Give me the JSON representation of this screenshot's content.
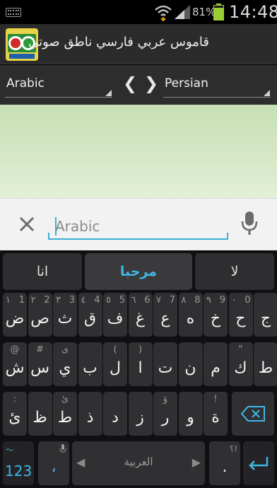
{
  "status_bar": {
    "battery_percent": "81%",
    "time": "14:48",
    "icons": [
      "keyboard-icon",
      "wifi-icon",
      "signal-icon",
      "battery-icon"
    ]
  },
  "app": {
    "title": "قاموس عربي فارسي ناطق صوتي",
    "icon": "app-logo-icon"
  },
  "languages": {
    "source": "Arabic",
    "target": "Persian",
    "left_arrow": "❮",
    "right_arrow": "❯"
  },
  "input": {
    "placeholder": "Arabic",
    "value": ""
  },
  "suggestions": {
    "left": "انا",
    "middle": "مرحبا",
    "right": "لا"
  },
  "keyboard": {
    "row1": [
      {
        "hint": "١",
        "sub": "1",
        "main": "ض"
      },
      {
        "hint": "٢",
        "sub": "2",
        "main": "ص"
      },
      {
        "hint": "٣",
        "sub": "3",
        "main": "ث"
      },
      {
        "hint": "٤",
        "sub": "4",
        "main": "ق"
      },
      {
        "hint": "٥",
        "sub": "5",
        "main": "ف"
      },
      {
        "hint": "٦",
        "sub": "6",
        "main": "غ"
      },
      {
        "hint": "٧",
        "sub": "7",
        "main": "ع"
      },
      {
        "hint": "٨",
        "sub": "8",
        "main": "ه"
      },
      {
        "hint": "٩",
        "sub": "9",
        "main": "خ"
      },
      {
        "hint": "٠",
        "sub": "0",
        "main": "ح"
      },
      {
        "hint": "",
        "sub": "",
        "main": "ج"
      }
    ],
    "row2": [
      {
        "hint": "@",
        "main": "ش"
      },
      {
        "hint": "#",
        "main": "س"
      },
      {
        "hint": "ى",
        "main": "ي"
      },
      {
        "hint": "",
        "main": "ب"
      },
      {
        "hint": "(",
        "main": "ل"
      },
      {
        "hint": ")",
        "main": "ا"
      },
      {
        "hint": "",
        "main": "ت"
      },
      {
        "hint": "",
        "main": "ن"
      },
      {
        "hint": "",
        "main": "م"
      },
      {
        "hint": "\"",
        "main": "ك"
      },
      {
        "hint": "",
        "main": "ط"
      }
    ],
    "row3": [
      {
        "hint": ":",
        "main": "ئ"
      },
      {
        "hint": "",
        "main": "ظ"
      },
      {
        "hint": "ئ",
        "main": "ط"
      },
      {
        "hint": "",
        "main": "ذ"
      },
      {
        "hint": "",
        "main": "د"
      },
      {
        "hint": "",
        "main": "ز"
      },
      {
        "hint": "ؤ",
        "main": "ر"
      },
      {
        "hint": "",
        "main": "و"
      },
      {
        "hint": "!",
        "main": "ة"
      }
    ],
    "numbers_key": "123",
    "comma_key": "،",
    "space_label": "العربية",
    "period_key": ".",
    "period_hint": "؟!",
    "mic_hint": "mic-icon"
  },
  "colors": {
    "accent": "#3bb0d4",
    "result_bg": "#d6e8c8",
    "keyboard_bg": "#101012",
    "key_bg": "#303033",
    "highlight": "#3fb7e6"
  }
}
